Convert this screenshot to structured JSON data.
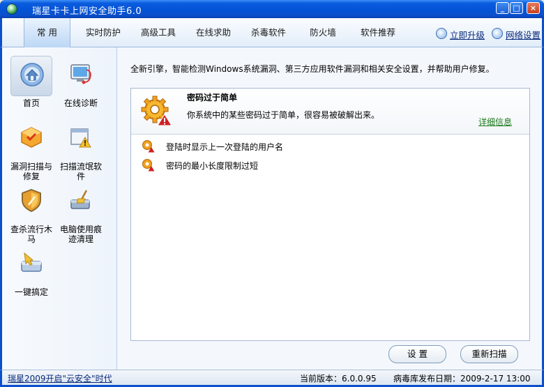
{
  "window": {
    "title": "瑞星卡卡上网安全助手6.0",
    "minimize_glyph": "_",
    "maximize_glyph": "□",
    "close_glyph": "×"
  },
  "nav": {
    "tabs": [
      {
        "label": "常 用",
        "active": true
      },
      {
        "label": "实时防护"
      },
      {
        "label": "高级工具"
      },
      {
        "label": "在线求助"
      },
      {
        "label": "杀毒软件"
      },
      {
        "label": "防火墙"
      },
      {
        "label": "软件推荐"
      }
    ],
    "upgrade_label": "立即升级",
    "network_label": "网络设置"
  },
  "sidebar": {
    "items": [
      {
        "label": "首页",
        "icon": "home-icon",
        "active": true
      },
      {
        "label": "在线诊断",
        "icon": "diagnosis-icon"
      },
      {
        "label": "漏洞扫描与修复",
        "icon": "vulnerability-icon"
      },
      {
        "label": "扫描流氓软件",
        "icon": "rogue-software-icon"
      },
      {
        "label": "查杀流行木马",
        "icon": "trojan-shield-icon"
      },
      {
        "label": "电脑使用痕迹清理",
        "icon": "broom-icon"
      },
      {
        "label": "一键搞定",
        "icon": "one-click-icon"
      }
    ]
  },
  "main": {
    "intro": "全新引擎，智能检测Windows系统漏洞、第三方应用软件漏洞和相关安全设置，并帮助用户修复。",
    "issue": {
      "title": "密码过于简单",
      "description": "你系统中的某些密码过于简单，很容易被破解出来。",
      "more_link": "详细信息",
      "icon": "warning-gear-icon"
    },
    "sub_issues": [
      "登陆时显示上一次登陆的用户名",
      "密码的最小长度限制过短"
    ],
    "settings_button": "设 置",
    "rescan_button": "重新扫描"
  },
  "status": {
    "slogan": "瑞星2009开启\"云安全\"时代",
    "version": "当前版本：6.0.0.95",
    "db_date": "病毒库发布日期：2009-2-17 13:00"
  },
  "colors": {
    "title_bar": "#0553D5",
    "accent": "#0A4FCB",
    "link_green": "#1B7A1B",
    "warning_orange": "#F0A020",
    "warning_red": "#D02020"
  }
}
